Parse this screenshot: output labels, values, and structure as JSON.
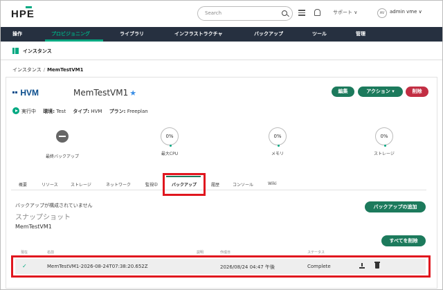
{
  "header": {
    "logo": "HPE",
    "search_placeholder": "Search",
    "support_label": "サポート ∨",
    "avatar_initials": "AV",
    "user_label": "admin vme ∨"
  },
  "nav": {
    "items": [
      "操作",
      "プロビジョニング",
      "ライブラリ",
      "インフラストラクチャ",
      "バックアップ",
      "ツール",
      "管理"
    ]
  },
  "subheader": {
    "title": "インスタンス"
  },
  "breadcrumb": {
    "parent": "インスタンス",
    "separator": "/",
    "current": "MemTestVM1"
  },
  "instance": {
    "type_logo": "HVM",
    "name": "MemTestVM1",
    "star": "★",
    "buttons": {
      "edit": "編集",
      "actions": "アクション ▾",
      "delete": "削除"
    },
    "status": {
      "state": "実行中",
      "env_label": "環境:",
      "env_value": "Test",
      "type_label": "タイプ:",
      "type_value": "HVM",
      "plan_label": "プラン:",
      "plan_value": "Freeplan"
    },
    "stats": {
      "last_backup_label": "最終バックアップ",
      "cpu_value": "0%",
      "cpu_label": "最大CPU",
      "memory_value": "0%",
      "memory_label": "メモリ",
      "storage_value": "0%",
      "storage_label": "ストレージ"
    }
  },
  "tabs": [
    "概要",
    "リソース",
    "ストレージ",
    "ネットワーク",
    "監視中",
    "バックアップ",
    "履歴",
    "コンソール",
    "Wiki"
  ],
  "backup": {
    "not_configured": "バックアップが構成されていません",
    "add_button": "バックアップの追加",
    "snapshot_title": "スナップショット",
    "snapshot_vm": "MemTestVM1",
    "delete_all_button": "すべてを削除",
    "columns": [
      "現在",
      "名前",
      "説明",
      "作成日",
      "ステータス"
    ],
    "row": {
      "current": "✓",
      "name": "MemTestVM1-2026-08-24T07:38:20.652Z",
      "created": "2026/08/24 04:47 午後",
      "status": "Complete"
    }
  }
}
